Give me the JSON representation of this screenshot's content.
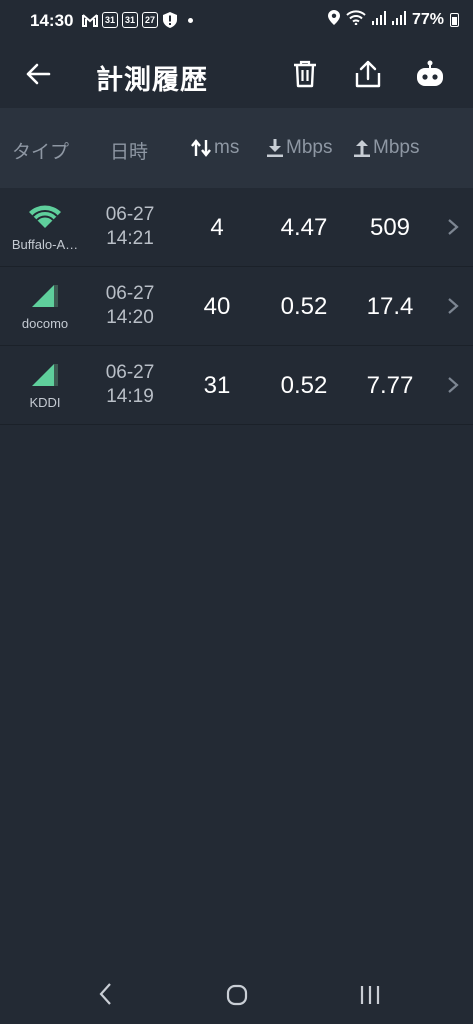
{
  "status_bar": {
    "time": "14:30",
    "left_icons": [
      "gmail-icon",
      "calendar-31-icon",
      "calendar-31-icon",
      "calendar-27-icon",
      "alert-shield-icon"
    ],
    "cal1": "31",
    "cal2": "31",
    "cal3": "27",
    "battery": "77%"
  },
  "app_bar": {
    "title": "計測履歴"
  },
  "table": {
    "headers": {
      "type": "タイプ",
      "datetime": "日時",
      "ping": "ms",
      "download": "Mbps",
      "upload": "Mbps"
    },
    "rows": [
      {
        "network": "Buffalo-A…",
        "kind": "wifi",
        "date": "06-27",
        "time": "14:21",
        "ping": "4",
        "download": "4.47",
        "upload": "509"
      },
      {
        "network": "docomo",
        "kind": "cellular",
        "date": "06-27",
        "time": "14:20",
        "ping": "40",
        "download": "0.52",
        "upload": "17.4"
      },
      {
        "network": "KDDI",
        "kind": "cellular",
        "date": "06-27",
        "time": "14:19",
        "ping": "31",
        "download": "0.52",
        "upload": "7.77"
      }
    ]
  },
  "colors": {
    "background": "#232a34",
    "header_bg": "#2b333e",
    "accent_green": "#5fcf9c"
  }
}
